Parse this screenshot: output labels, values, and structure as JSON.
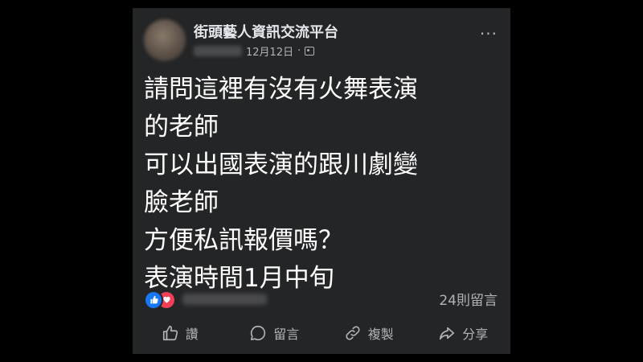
{
  "post": {
    "group_name": "街頭藝人資訊交流平台",
    "date": "12月12日",
    "meta_separator": "·",
    "more_label": "···",
    "text_lines": [
      "請問這裡有沒有火舞表演",
      "的老師",
      "可以出國表演的跟川劇變",
      "臉老師",
      "方便私訊報價嗎？",
      "表演時間1月中旬"
    ],
    "comment_count": "24則留言"
  },
  "actions": {
    "like_label": "讚",
    "comment_label": "留言",
    "copy_label": "複製",
    "share_label": "分享"
  },
  "icons": {
    "more": "more-dots-icon",
    "audience": "audience-icon",
    "like": "thumbs-up-icon",
    "love": "heart-icon",
    "comment": "comment-bubble-icon",
    "copy": "link-icon",
    "share": "share-arrow-icon"
  },
  "colors": {
    "card_bg": "#242526",
    "text_primary": "#ffffff",
    "text_secondary": "#b0b3b8",
    "like_blue": "#1877f2",
    "love_red": "#f33e58"
  }
}
